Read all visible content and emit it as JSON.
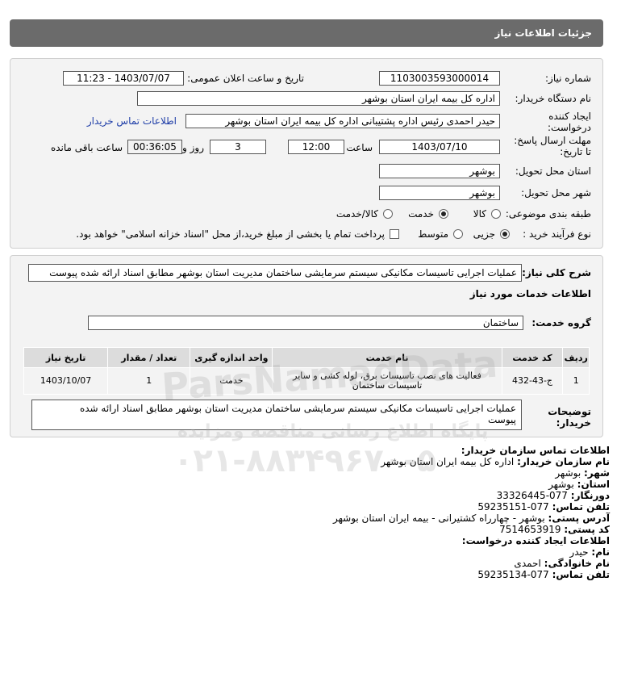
{
  "page_title": "جزئیات اطلاعات نیاز",
  "details": {
    "need_number_label": "شماره نیاز:",
    "need_number": "1103003593000014",
    "announce_label": "تاریخ و ساعت اعلان عمومی:",
    "announce_value": "1403/07/07 - 11:23",
    "buyer_org_label": "نام دستگاه خریدار:",
    "buyer_org": "اداره کل بیمه ایران استان بوشهر",
    "creator_label_1": "ایجاد کننده",
    "creator_label_2": "درخواست:",
    "creator": "حیدر احمدی رئیس اداره پشتیبانی اداره کل بیمه ایران استان بوشهر",
    "contact_link": "اطلاعات تماس خریدار",
    "deadline_label_1": "مهلت ارسال پاسخ:",
    "deadline_label_2": "تا تاریخ:",
    "deadline_date": "1403/07/10",
    "time_label": "ساعت",
    "deadline_time": "12:00",
    "days_value": "3",
    "days_label": "روز و",
    "remaining_time": "00:36:05",
    "remaining_label": "ساعت باقی مانده",
    "province_label": "استان محل تحویل:",
    "province": "بوشهر",
    "city_label": "شهر محل تحویل:",
    "city": "بوشهر",
    "category_label": "طبقه بندی موضوعی:",
    "category_options": [
      "کالا",
      "خدمت",
      "کالا/خدمت"
    ],
    "purchase_type_label": "نوع فرآیند خرید :",
    "purchase_options": [
      "جزیی",
      "متوسط"
    ],
    "payment_note": "پرداخت تمام یا بخشی از مبلغ خرید،از محل \"اسناد خزانه اسلامی\" خواهد بود."
  },
  "need": {
    "summary_label": "شرح کلی نیاز:",
    "summary": "عملیات اجرایی تاسیسات مکانیکی سیستم سرمایشی ساختمان مدیریت استان بوشهر مطابق اسناد ارائه شده پیوست",
    "services_heading": "اطلاعات خدمات مورد نیاز",
    "service_group_label": "گروه خدمت:",
    "service_group": "ساختمان",
    "table": {
      "headers": [
        "ردیف",
        "کد خدمت",
        "نام خدمت",
        "واحد اندازه گیری",
        "تعداد / مقدار",
        "تاریخ نیاز"
      ],
      "rows": [
        {
          "row": "1",
          "code": "ج-43-432",
          "name_line1": "فعالیت های نصب تاسیسات برق، لوله کشی و سایر",
          "name_line2": "تاسیسات ساختمان",
          "unit": "خدمت",
          "qty": "1",
          "date": "1403/10/07"
        }
      ]
    },
    "buyer_notes_label_1": "توضیحات",
    "buyer_notes_label_2": "خریدار:",
    "buyer_notes_line1": "عملیات اجرایی تاسیسات مکانیکی سیستم سرمایشی ساختمان مدیریت استان بوشهر مطابق اسناد ارائه شده",
    "buyer_notes_line2": "پیوست"
  },
  "contact": {
    "heading": "اطلاعات تماس سازمان خریدار:",
    "org_label": "نام سازمان خریدار:",
    "org": "اداره کل بیمه ایران استان بوشهر",
    "city_label": "شهر:",
    "city": "بوشهر",
    "province_label": "استان:",
    "province": "بوشهر",
    "fax_label": "دورنگار:",
    "fax": "077-33326445",
    "phone_label": "تلفن تماس:",
    "phone": "077-59235151",
    "address_label": "آدرس پستی:",
    "address": "بوشهر - چهارراه کشتیرانی - بیمه ایران استان بوشهر",
    "postal_label": "کد پستی:",
    "postal": "7514653919",
    "creator_heading": "اطلاعات ایجاد کننده درخواست:",
    "first_name_label": "نام:",
    "first_name": "حیدر",
    "last_name_label": "نام خانوادگی:",
    "last_name": "احمدی",
    "creator_phone_label": "تلفن تماس:",
    "creator_phone": "077-59235134"
  },
  "watermark": {
    "brand": "ParsNamadData",
    "tagline": "پایگاه اطلاع رسانی مناقصه ومزایده",
    "phone": "۰۲۱-۸۸۳۴۹۶۷۰-۵"
  },
  "colors": {
    "title_bar": "#6b6b6b",
    "panel": "#f3f3f3",
    "table_header": "#dcdcdc",
    "link": "#1f3ea8"
  }
}
